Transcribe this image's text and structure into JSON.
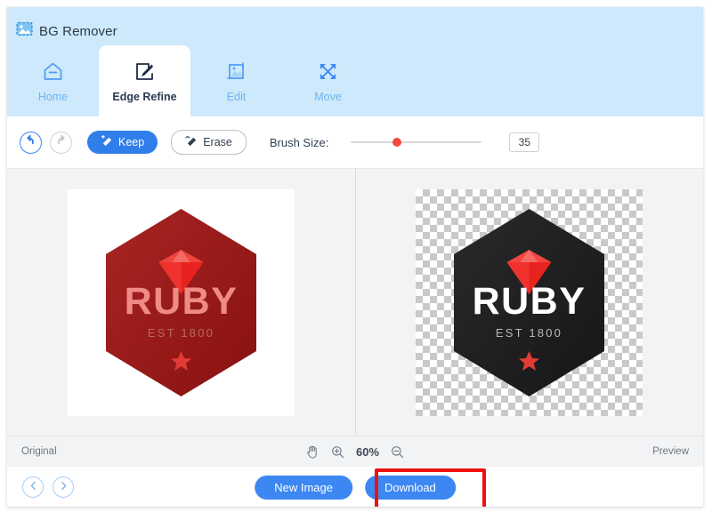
{
  "app": {
    "title": "BG Remover",
    "logo_icon": "image-photo-icon"
  },
  "tabs": [
    {
      "label": "Home",
      "icon": "home-icon",
      "active": false
    },
    {
      "label": "Edge Refine",
      "icon": "edge-refine-pen-icon",
      "active": true
    },
    {
      "label": "Edit",
      "icon": "edit-crop-image-icon",
      "active": false
    },
    {
      "label": "Move",
      "icon": "move-four-arrows-icon",
      "active": false
    }
  ],
  "toolbar": {
    "undo_icon": "undo-arrow-icon",
    "redo_icon": "redo-arrow-icon",
    "keep_label": "Keep",
    "keep_icon": "keep-brush-icon",
    "erase_label": "Erase",
    "erase_icon": "erase-brush-icon",
    "brush_size_label": "Brush Size:",
    "brush_size_value": "35",
    "slider_percent": 35,
    "slider_thumb_color": "#f5493d",
    "keep_active": true
  },
  "canvas": {
    "left": {
      "background": "white",
      "logo": {
        "brand": "RUBY",
        "tagline": "EST 1800",
        "hexagon_color": "#9e1f1c",
        "gem_color": "#f0322f",
        "text_color": "#ef8a86",
        "tagline_color": "#b56a63",
        "star_color": "#e03b34"
      }
    },
    "right": {
      "background": "transparent-checkerboard",
      "logo": {
        "brand": "RUBY",
        "tagline": "EST 1800",
        "hexagon_color": "#1f1f21",
        "gem_color": "#f0322f",
        "text_color": "#ffffff",
        "tagline_color": "#b9b9ba",
        "star_color": "#e03b34"
      }
    }
  },
  "statusbar": {
    "original_label": "Original",
    "preview_label": "Preview",
    "hand_icon": "hand-pan-icon",
    "zoom_in_icon": "zoom-in-icon",
    "zoom_out_icon": "zoom-out-icon",
    "zoom_level": "60%"
  },
  "footer": {
    "prev_icon": "chevron-left-icon",
    "next_icon": "chevron-right-icon",
    "new_image_label": "New Image",
    "download_label": "Download",
    "download_highlighted": true,
    "highlight_color": "#ee1111",
    "button_color": "#3c87f2"
  }
}
